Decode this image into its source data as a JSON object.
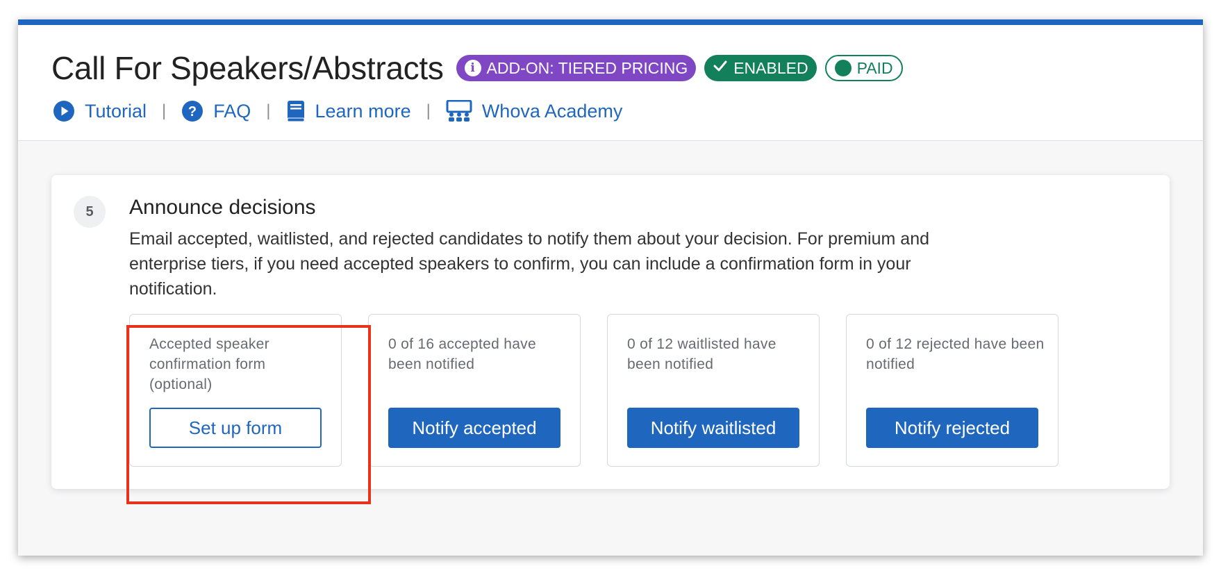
{
  "header": {
    "title": "Call For Speakers/Abstracts",
    "badges": [
      {
        "label": "ADD-ON: TIERED PRICING",
        "icon": "info-icon",
        "color": "#8047c4"
      },
      {
        "label": "ENABLED",
        "icon": "check-icon",
        "color": "#12805a"
      },
      {
        "label": "PAID",
        "icon": "dot-icon",
        "color": "#12805a"
      }
    ],
    "links": [
      {
        "label": "Tutorial",
        "icon": "play-icon"
      },
      {
        "label": "FAQ",
        "icon": "question-icon"
      },
      {
        "label": "Learn more",
        "icon": "book-icon"
      },
      {
        "label": "Whova Academy",
        "icon": "classroom-icon"
      }
    ],
    "separator": "|"
  },
  "step": {
    "number": "5",
    "title": "Announce decisions",
    "description": "Email accepted, waitlisted, and rejected candidates to notify them about your decision. For premium and enterprise tiers, if you need accepted speakers to confirm, you can include a confirmation form in your notification.",
    "options": [
      {
        "text": "Accepted speaker confirmation form (optional)",
        "button": "Set up form",
        "style": "outline"
      },
      {
        "text": "0 of 16 accepted have been notified",
        "button": "Notify accepted",
        "style": "solid"
      },
      {
        "text": "0 of 12 waitlisted have been notified",
        "button": "Notify waitlisted",
        "style": "solid"
      },
      {
        "text": "0 of 12 rejected have been notified",
        "button": "Notify rejected",
        "style": "solid"
      }
    ]
  },
  "colors": {
    "accent": "#1f66bf",
    "highlight": "#e8321b",
    "purple": "#8047c4",
    "green": "#12805a"
  }
}
